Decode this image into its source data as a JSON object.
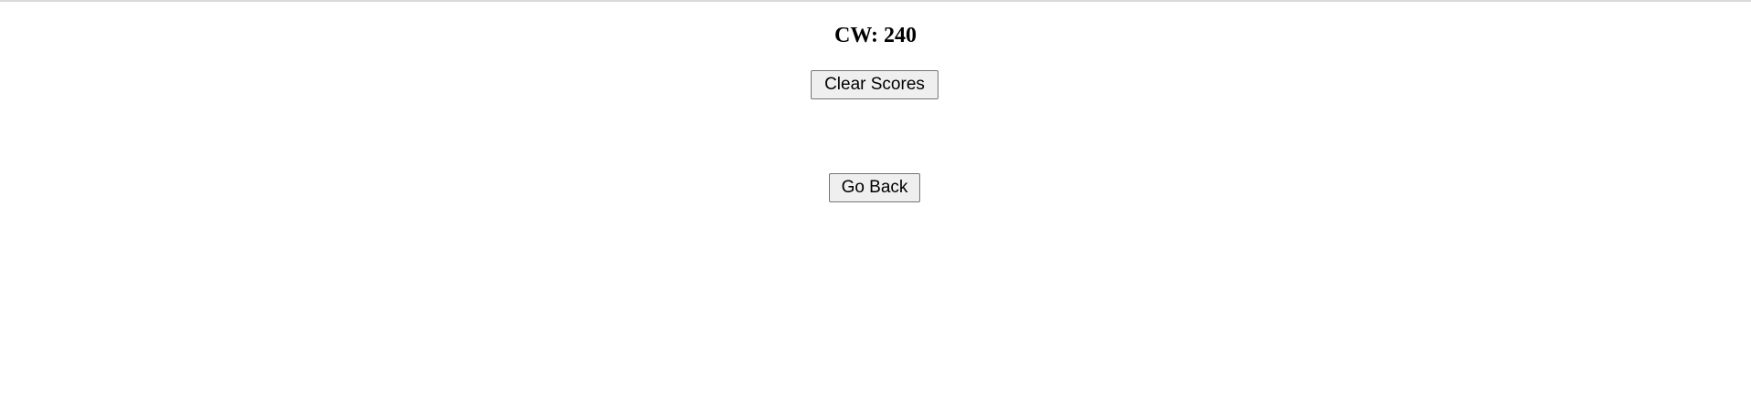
{
  "scores": {
    "heading": "CW: 240"
  },
  "actions": {
    "clear_label": "Clear Scores",
    "back_label": "Go Back"
  }
}
